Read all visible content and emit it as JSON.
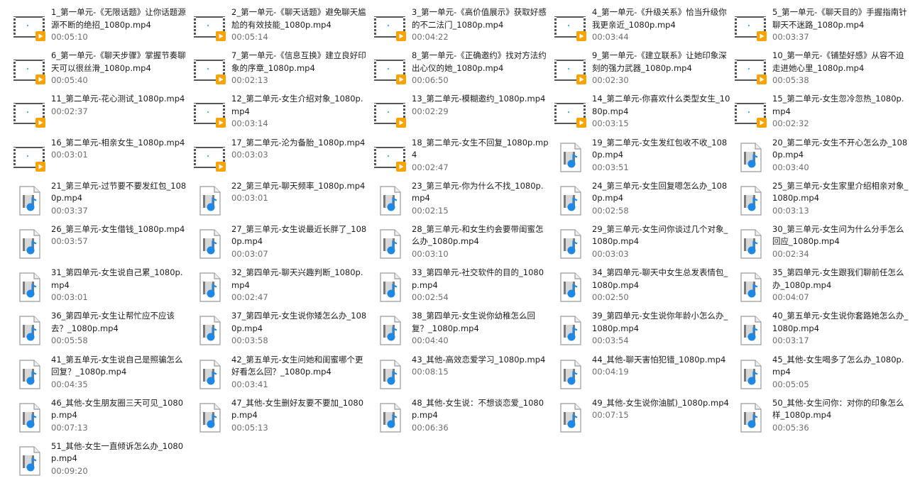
{
  "files": [
    {
      "name": "1_第一单元-《无限话题》让你话题源源不断的绝招_1080p.mp4",
      "duration": "00:05:10",
      "icon": "video-thumbnail-icon"
    },
    {
      "name": "2_第一单元-《聊天话题》避免聊天尴尬的有效技能_1080p.mp4",
      "duration": "00:05:14",
      "icon": "video-thumbnail-icon"
    },
    {
      "name": "3_第一单元-《高价值展示》获取好感的不二法门_1080p.mp4",
      "duration": "00:04:22",
      "icon": "video-thumbnail-icon"
    },
    {
      "name": "4_第一单元-《升级关系》恰当升级你我更亲近_1080p.mp4",
      "duration": "00:03:44",
      "icon": "video-thumbnail-icon"
    },
    {
      "name": "5_第一单元-《聊天目的》手握指南针聊天不迷路_1080p.mp4",
      "duration": "00:03:37",
      "icon": "video-thumbnail-icon"
    },
    {
      "name": "6_第一单元-《聊天步骤》掌握节奏聊天可以很丝滑_1080p.mp4",
      "duration": "00:05:40",
      "icon": "video-thumbnail-icon"
    },
    {
      "name": "7_第一单元-《信息互换》建立良好印象的序章_1080p.mp4",
      "duration": "00:02:13",
      "icon": "video-thumbnail-icon"
    },
    {
      "name": "8_第一单元-《正确邀约》找对方法约出心仪的她_1080p.mp4",
      "duration": "00:06:50",
      "icon": "video-thumbnail-icon"
    },
    {
      "name": "9_第一单元-《建立联系》让她印象深刻的强力武器_1080p.mp4",
      "duration": "00:02:30",
      "icon": "video-thumbnail-icon"
    },
    {
      "name": "10_第一单元-《铺垫好感》从容不迫走进她心里_1080p.mp4",
      "duration": "00:05:38",
      "icon": "video-thumbnail-icon"
    },
    {
      "name": "11_第二单元-花心测试_1080p.mp4",
      "duration": "00:02:37",
      "icon": "video-thumbnail-icon"
    },
    {
      "name": "12_第二单元-女生介绍对象_1080p.mp4",
      "duration": "00:03:14",
      "icon": "video-thumbnail-icon"
    },
    {
      "name": "13_第二单元-模糊邀约_1080p.mp4",
      "duration": "00:02:29",
      "icon": "video-thumbnail-icon"
    },
    {
      "name": "14_第二单元-你喜欢什么类型女生_1080p.mp4",
      "duration": "00:03:15",
      "icon": "video-thumbnail-icon"
    },
    {
      "name": "15_第二单元-女生忽冷忽热_1080p.mp4",
      "duration": "00:02:32",
      "icon": "video-thumbnail-icon"
    },
    {
      "name": "16_第二单元-相亲女生_1080p.mp4",
      "duration": "00:03:01",
      "icon": "video-thumbnail-icon"
    },
    {
      "name": "17_第二单元-沦为备胎_1080p.mp4",
      "duration": "00:03:03",
      "icon": "video-thumbnail-icon"
    },
    {
      "name": "18_第二单元-女生不回复_1080p.mp4",
      "duration": "00:02:47",
      "icon": "video-thumbnail-icon"
    },
    {
      "name": "19_第二单元-女生发红包收不收_1080p.mp4",
      "duration": "00:03:51",
      "icon": "media-file-icon"
    },
    {
      "name": "20_第二单元-女生不开心怎么办_1080p.mp4",
      "duration": "00:03:40",
      "icon": "media-file-icon"
    },
    {
      "name": "21_第三单元-过节要不要发红包_1080p.mp4",
      "duration": "00:03:37",
      "icon": "media-file-icon"
    },
    {
      "name": "22_第三单元-聊天频率_1080p.mp4",
      "duration": "00:03:01",
      "icon": "media-file-icon"
    },
    {
      "name": "23_第三单元-你为什么不找_1080p.mp4",
      "duration": "00:02:15",
      "icon": "media-file-icon"
    },
    {
      "name": "24_第三单元-女生回复嗯怎么办_1080p.mp4",
      "duration": "00:02:58",
      "icon": "media-file-icon"
    },
    {
      "name": "25_第三单元-女生家里介绍相亲对象_1080p.mp4",
      "duration": "00:03:13",
      "icon": "media-file-icon"
    },
    {
      "name": "26_第三单元-女生借钱_1080p.mp4",
      "duration": "00:03:57",
      "icon": "media-file-icon"
    },
    {
      "name": "27_第三单元-女生说最近长胖了_1080p.mp4",
      "duration": "00:03:07",
      "icon": "media-file-icon"
    },
    {
      "name": "28_第三单元-和女生约会要带闺蜜怎么办_1080p.mp4",
      "duration": "00:03:10",
      "icon": "media-file-icon"
    },
    {
      "name": "29_第三单元-女生问你谈过几个对象_1080p.mp4",
      "duration": "00:03:03",
      "icon": "media-file-icon"
    },
    {
      "name": "30_第三单元-女生问为什么分手怎么回应_1080p.mp4",
      "duration": "00:02:34",
      "icon": "media-file-icon"
    },
    {
      "name": "31_第四单元-女生说自己累_1080p.mp4",
      "duration": "00:03:01",
      "icon": "media-file-icon"
    },
    {
      "name": "32_第四单元-聊天兴趣判断_1080p.mp4",
      "duration": "00:02:47",
      "icon": "media-file-icon"
    },
    {
      "name": "33_第四单元-社交软件的目的_1080p.mp4",
      "duration": "00:02:54",
      "icon": "media-file-icon"
    },
    {
      "name": "34_第四单元-聊天中女生总发表情包_1080p.mp4",
      "duration": "00:02:50",
      "icon": "media-file-icon"
    },
    {
      "name": "35_第四单元-女生跟我们聊前任怎么办_1080p.mp4",
      "duration": "00:04:07",
      "icon": "media-file-icon"
    },
    {
      "name": "36_第四单元-女生让帮忙应不应该去？_1080p.mp4",
      "duration": "00:05:58",
      "icon": "media-file-icon"
    },
    {
      "name": "37_第四单元-女生说你矮怎么办_1080p.mp4",
      "duration": "00:03:58",
      "icon": "media-file-icon"
    },
    {
      "name": "38_第四单元-女生说你幼稚怎么回复？_1080p.mp4",
      "duration": "00:04:40",
      "icon": "media-file-icon"
    },
    {
      "name": "39_第四单元-女生说你年龄小怎么办_1080p.mp4",
      "duration": "00:03:54",
      "icon": "media-file-icon"
    },
    {
      "name": "40_第五单元-女生说你套路她怎么办_1080p.mp4",
      "duration": "00:03:17",
      "icon": "media-file-icon"
    },
    {
      "name": "41_第五单元-女生说自己是照骗怎么回复？_1080p.mp4",
      "duration": "00:04:35",
      "icon": "media-file-icon"
    },
    {
      "name": "42_第五单元-女生问她和闺蜜哪个更好看怎么回？_1080p.mp4",
      "duration": "00:03:41",
      "icon": "media-file-icon"
    },
    {
      "name": "43_其他-高效恋爱学习_1080p.mp4",
      "duration": "00:08:15",
      "icon": "media-file-icon"
    },
    {
      "name": "44_其他-聊天害怕犯错_1080p.mp4",
      "duration": "00:04:19",
      "icon": "media-file-icon"
    },
    {
      "name": "45_其他-女生喝多了怎么办_1080p.mp4",
      "duration": "00:05:05",
      "icon": "media-file-icon"
    },
    {
      "name": "46_其他-女生朋友圈三天可见_1080p.mp4",
      "duration": "00:07:13",
      "icon": "media-file-icon"
    },
    {
      "name": "47_其他-女生删好友要不要加_1080p.mp4",
      "duration": "00:05:13",
      "icon": "media-file-icon"
    },
    {
      "name": "48_其他-女生说：不想谈恋爱_1080p.mp4",
      "duration": "00:06:36",
      "icon": "media-file-icon"
    },
    {
      "name": "49_其他-女生说你油腻)_1080p.mp4",
      "duration": "00:07:15",
      "icon": "media-file-icon"
    },
    {
      "name": "50_其他-女生问你：对你的印象怎么样_1080p.mp4",
      "duration": "00:05:36",
      "icon": "media-file-icon"
    },
    {
      "name": "51_其他-女生一直倾诉怎么办_1080p.mp4",
      "duration": "00:09:20",
      "icon": "media-file-icon"
    }
  ],
  "colors": {
    "thumb_frame": "#555555",
    "thumb_bg": "#ffffff",
    "play_badge": "#f7a300",
    "doc_border": "#9a9a9a",
    "media_blue": "#1e88e5",
    "duration_text": "#6d6d6d"
  }
}
